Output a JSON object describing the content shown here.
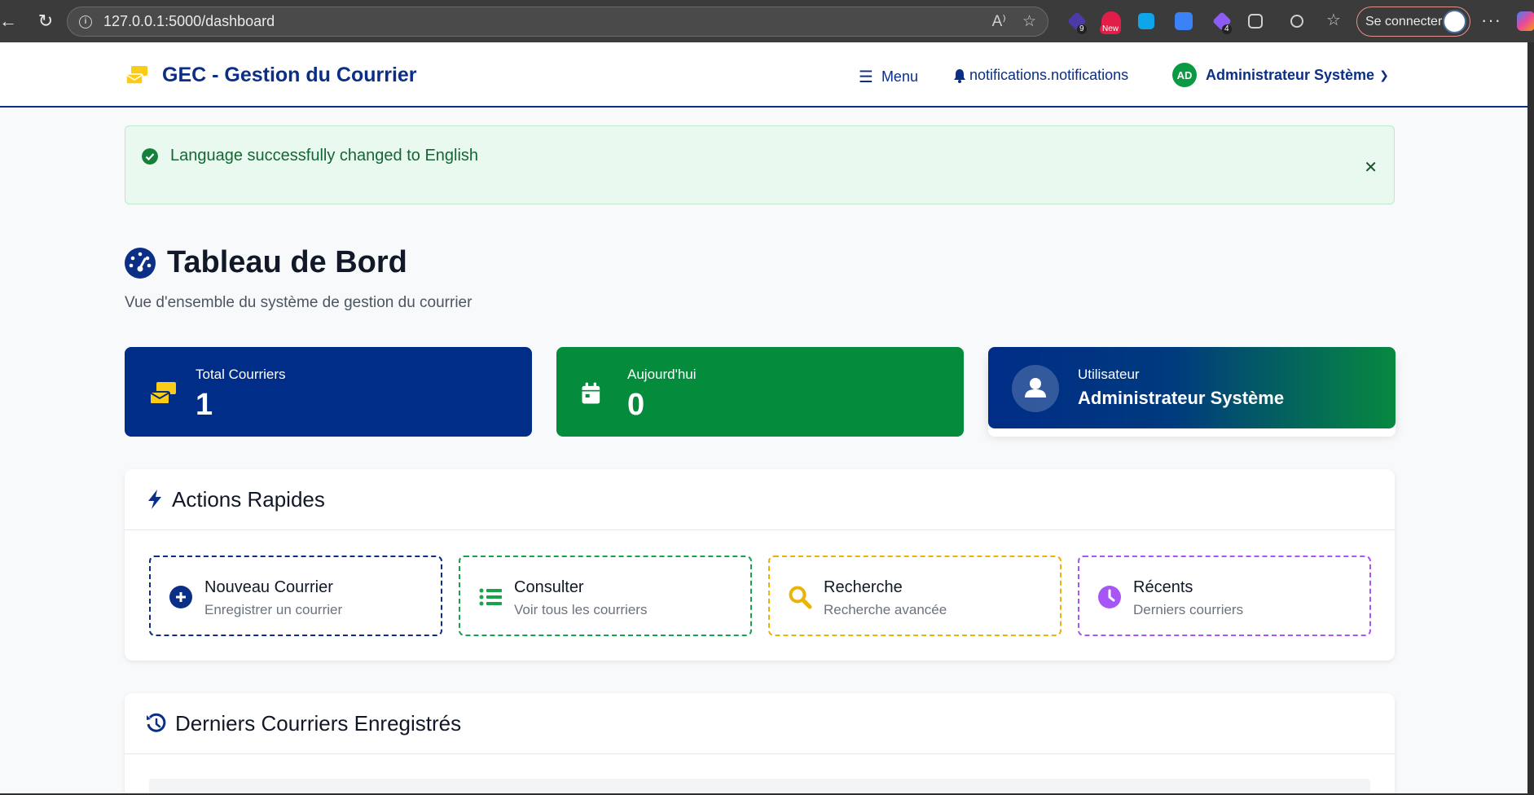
{
  "browser": {
    "url": "127.0.0.1:5000/dashboard",
    "signin_label": "Se connecter",
    "ext_badges": [
      "9",
      "New",
      "4"
    ]
  },
  "header": {
    "brand": "GEC - Gestion du Courrier",
    "menu_label": "Menu",
    "notifications_label": "notifications.notifications",
    "user_initials": "AD",
    "user_name": "Administrateur Système"
  },
  "alert": {
    "message": "Language successfully changed to English",
    "close_symbol": "✕"
  },
  "page": {
    "title": "Tableau de Bord",
    "subtitle": "Vue d'ensemble du système de gestion du courrier"
  },
  "stats": [
    {
      "label": "Total Courriers",
      "value": "1"
    },
    {
      "label": "Aujourd'hui",
      "value": "0"
    },
    {
      "label": "Utilisateur",
      "value": "Administrateur Système"
    }
  ],
  "quick_actions": {
    "title": "Actions Rapides",
    "items": [
      {
        "title": "Nouveau Courrier",
        "subtitle": "Enregistrer un courrier",
        "color": "#0b2e86",
        "icon": "plus-circle-icon"
      },
      {
        "title": "Consulter",
        "subtitle": "Voir tous les courriers",
        "color": "#16a34a",
        "icon": "list-icon"
      },
      {
        "title": "Recherche",
        "subtitle": "Recherche avancée",
        "color": "#eab308",
        "icon": "search-icon"
      },
      {
        "title": "Récents",
        "subtitle": "Derniers courriers",
        "color": "#a855f7",
        "icon": "clock-icon"
      }
    ]
  },
  "recent": {
    "title": "Derniers Courriers Enregistrés"
  },
  "colors": {
    "primary": "#0b2e86",
    "success": "#048c3c",
    "accent_yellow": "#facc15"
  }
}
